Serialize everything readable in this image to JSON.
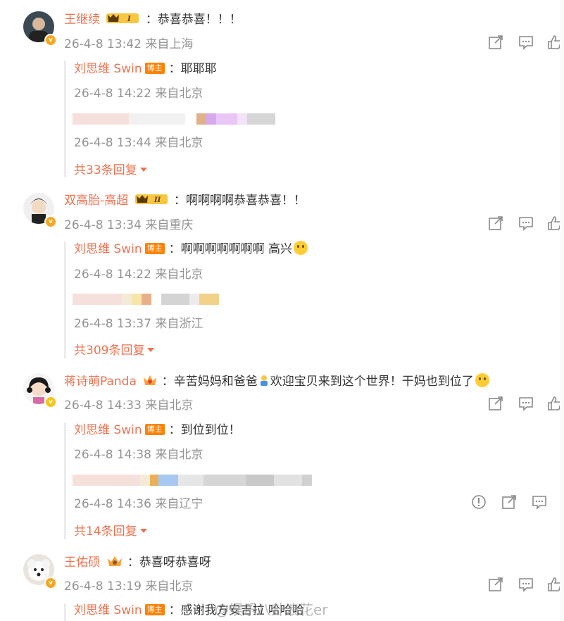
{
  "comments": [
    {
      "username": "王继续",
      "text": "：恭喜恭喜！！！",
      "timestamp": "26-4-8 13:42",
      "location": "来自上海",
      "reply": {
        "username": "刘思维 Swin",
        "host_badge": "博主",
        "text": "：耶耶耶",
        "timestamp": "26-4-8 14:22",
        "location": "来自北京"
      },
      "hidden_reply": {
        "timestamp": "26-4-8 13:44",
        "location": "来自北京"
      },
      "more": "共33条回复"
    },
    {
      "username": "双高胎-高超",
      "text": "：啊啊啊啊恭喜恭喜！！",
      "timestamp": "26-4-8 13:34",
      "location": "来自重庆",
      "reply": {
        "username": "刘思维 Swin",
        "host_badge": "博主",
        "text": "：啊啊啊啊啊啊啊 高兴",
        "timestamp": "26-4-8 14:22",
        "location": "来自北京"
      },
      "hidden_reply": {
        "timestamp": "26-4-8 13:37",
        "location": "来自浙江"
      },
      "more": "共309条回复"
    },
    {
      "username": "蒋诗萌Panda",
      "text": "：辛苦妈妈和爸爸",
      "text2": "欢迎宝贝来到这个世界！干妈也到位了",
      "timestamp": "26-4-8 14:33",
      "location": "来自北京",
      "reply": {
        "username": "刘思维 Swin",
        "host_badge": "博主",
        "text": "：到位到位！",
        "timestamp": "26-4-8 14:38",
        "location": "来自北京"
      },
      "hidden_reply": {
        "timestamp": "26-4-8 14:36",
        "location": "来自辽宁"
      },
      "more": "共14条回复"
    },
    {
      "username": "王佑硕",
      "text": "：恭喜呀恭喜呀",
      "timestamp": "26-4-8 13:19",
      "location": "来自北京",
      "reply": {
        "username": "刘思维 Swin",
        "host_badge": "博主",
        "text": "：感谢我方安吉拉 哈哈哈",
        "timestamp": "",
        "location": ""
      }
    }
  ],
  "vip_levels": [
    "I",
    "II"
  ],
  "watermark": "@娱乐八卦浪花er",
  "colors": {
    "username": "#eb7350",
    "meta": "#939393",
    "host_badge": "#ff8200"
  },
  "icons": [
    "share-icon",
    "comment-icon",
    "like-icon",
    "report-icon"
  ]
}
